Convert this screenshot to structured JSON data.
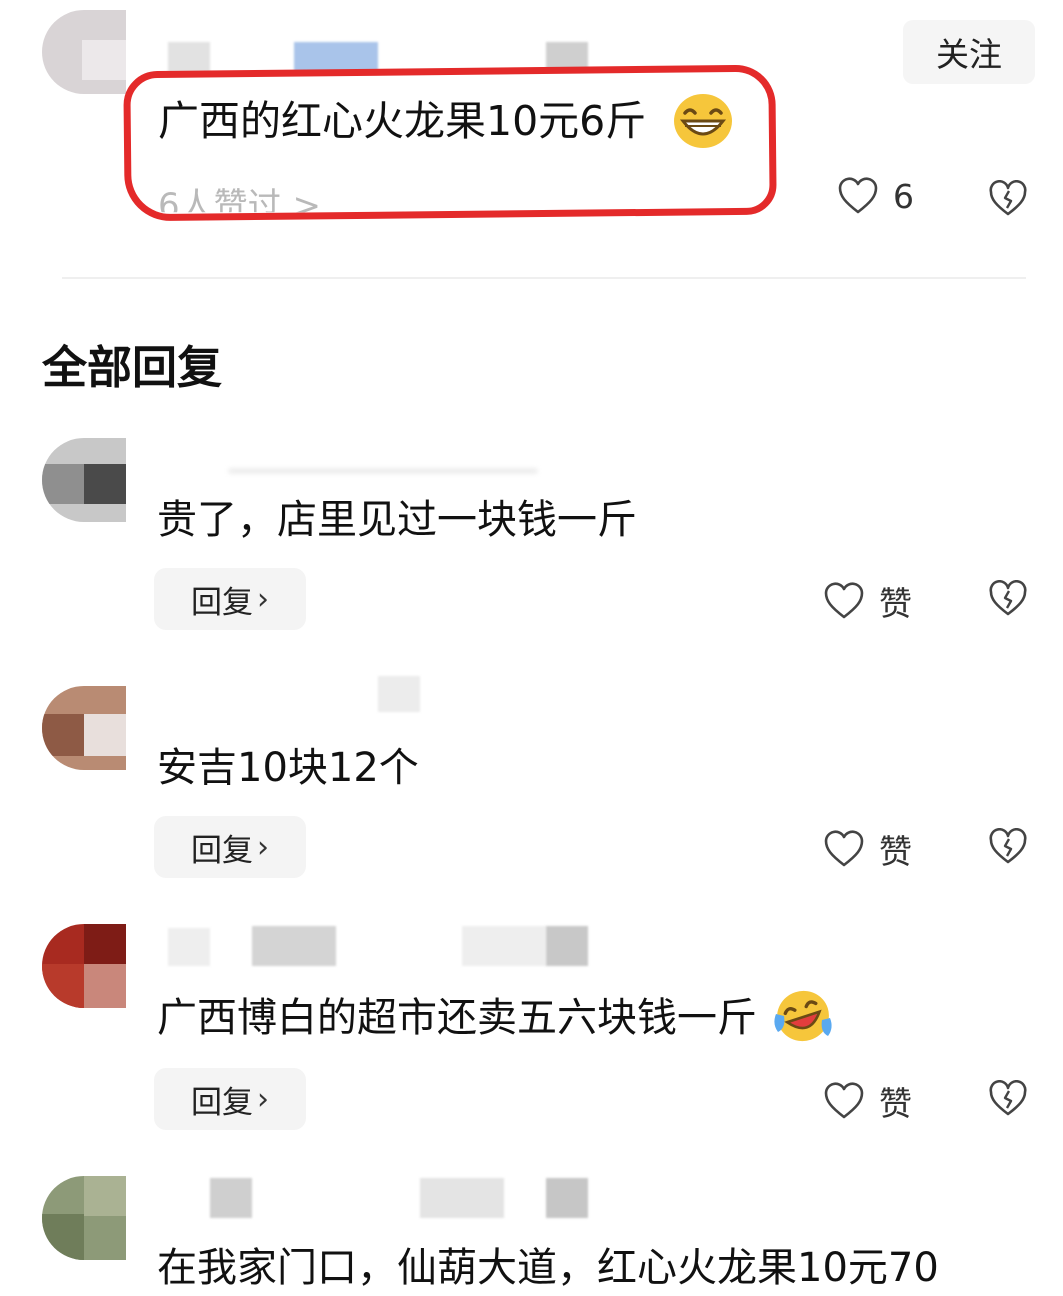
{
  "main_comment": {
    "follow_label": "关注",
    "text": "广西的红心火龙果10元6斤",
    "liked_by": "6人赞过 >",
    "like_count": "6",
    "emoji": "grinning-face-emoji"
  },
  "section_title": "全部回复",
  "replies": [
    {
      "text": "贵了，店里见过一块钱一斤",
      "reply_label": "回复",
      "like_label": "赞"
    },
    {
      "text": "安吉10块12个",
      "reply_label": "回复",
      "like_label": "赞"
    },
    {
      "text": "广西博白的超市还卖五六块钱一斤",
      "reply_label": "回复",
      "like_label": "赞",
      "emoji": "laughing-crying-emoji"
    },
    {
      "text": "在我家门口，仙葫大道，红心火龙果10元70"
    }
  ],
  "icons": {
    "like": "heart-outline-icon",
    "dislike": "broken-heart-icon",
    "chevron": "chevron-right-icon"
  },
  "colors": {
    "annotation_circle": "#e42a2a",
    "button_bg": "#f4f4f4",
    "text": "#111111"
  }
}
